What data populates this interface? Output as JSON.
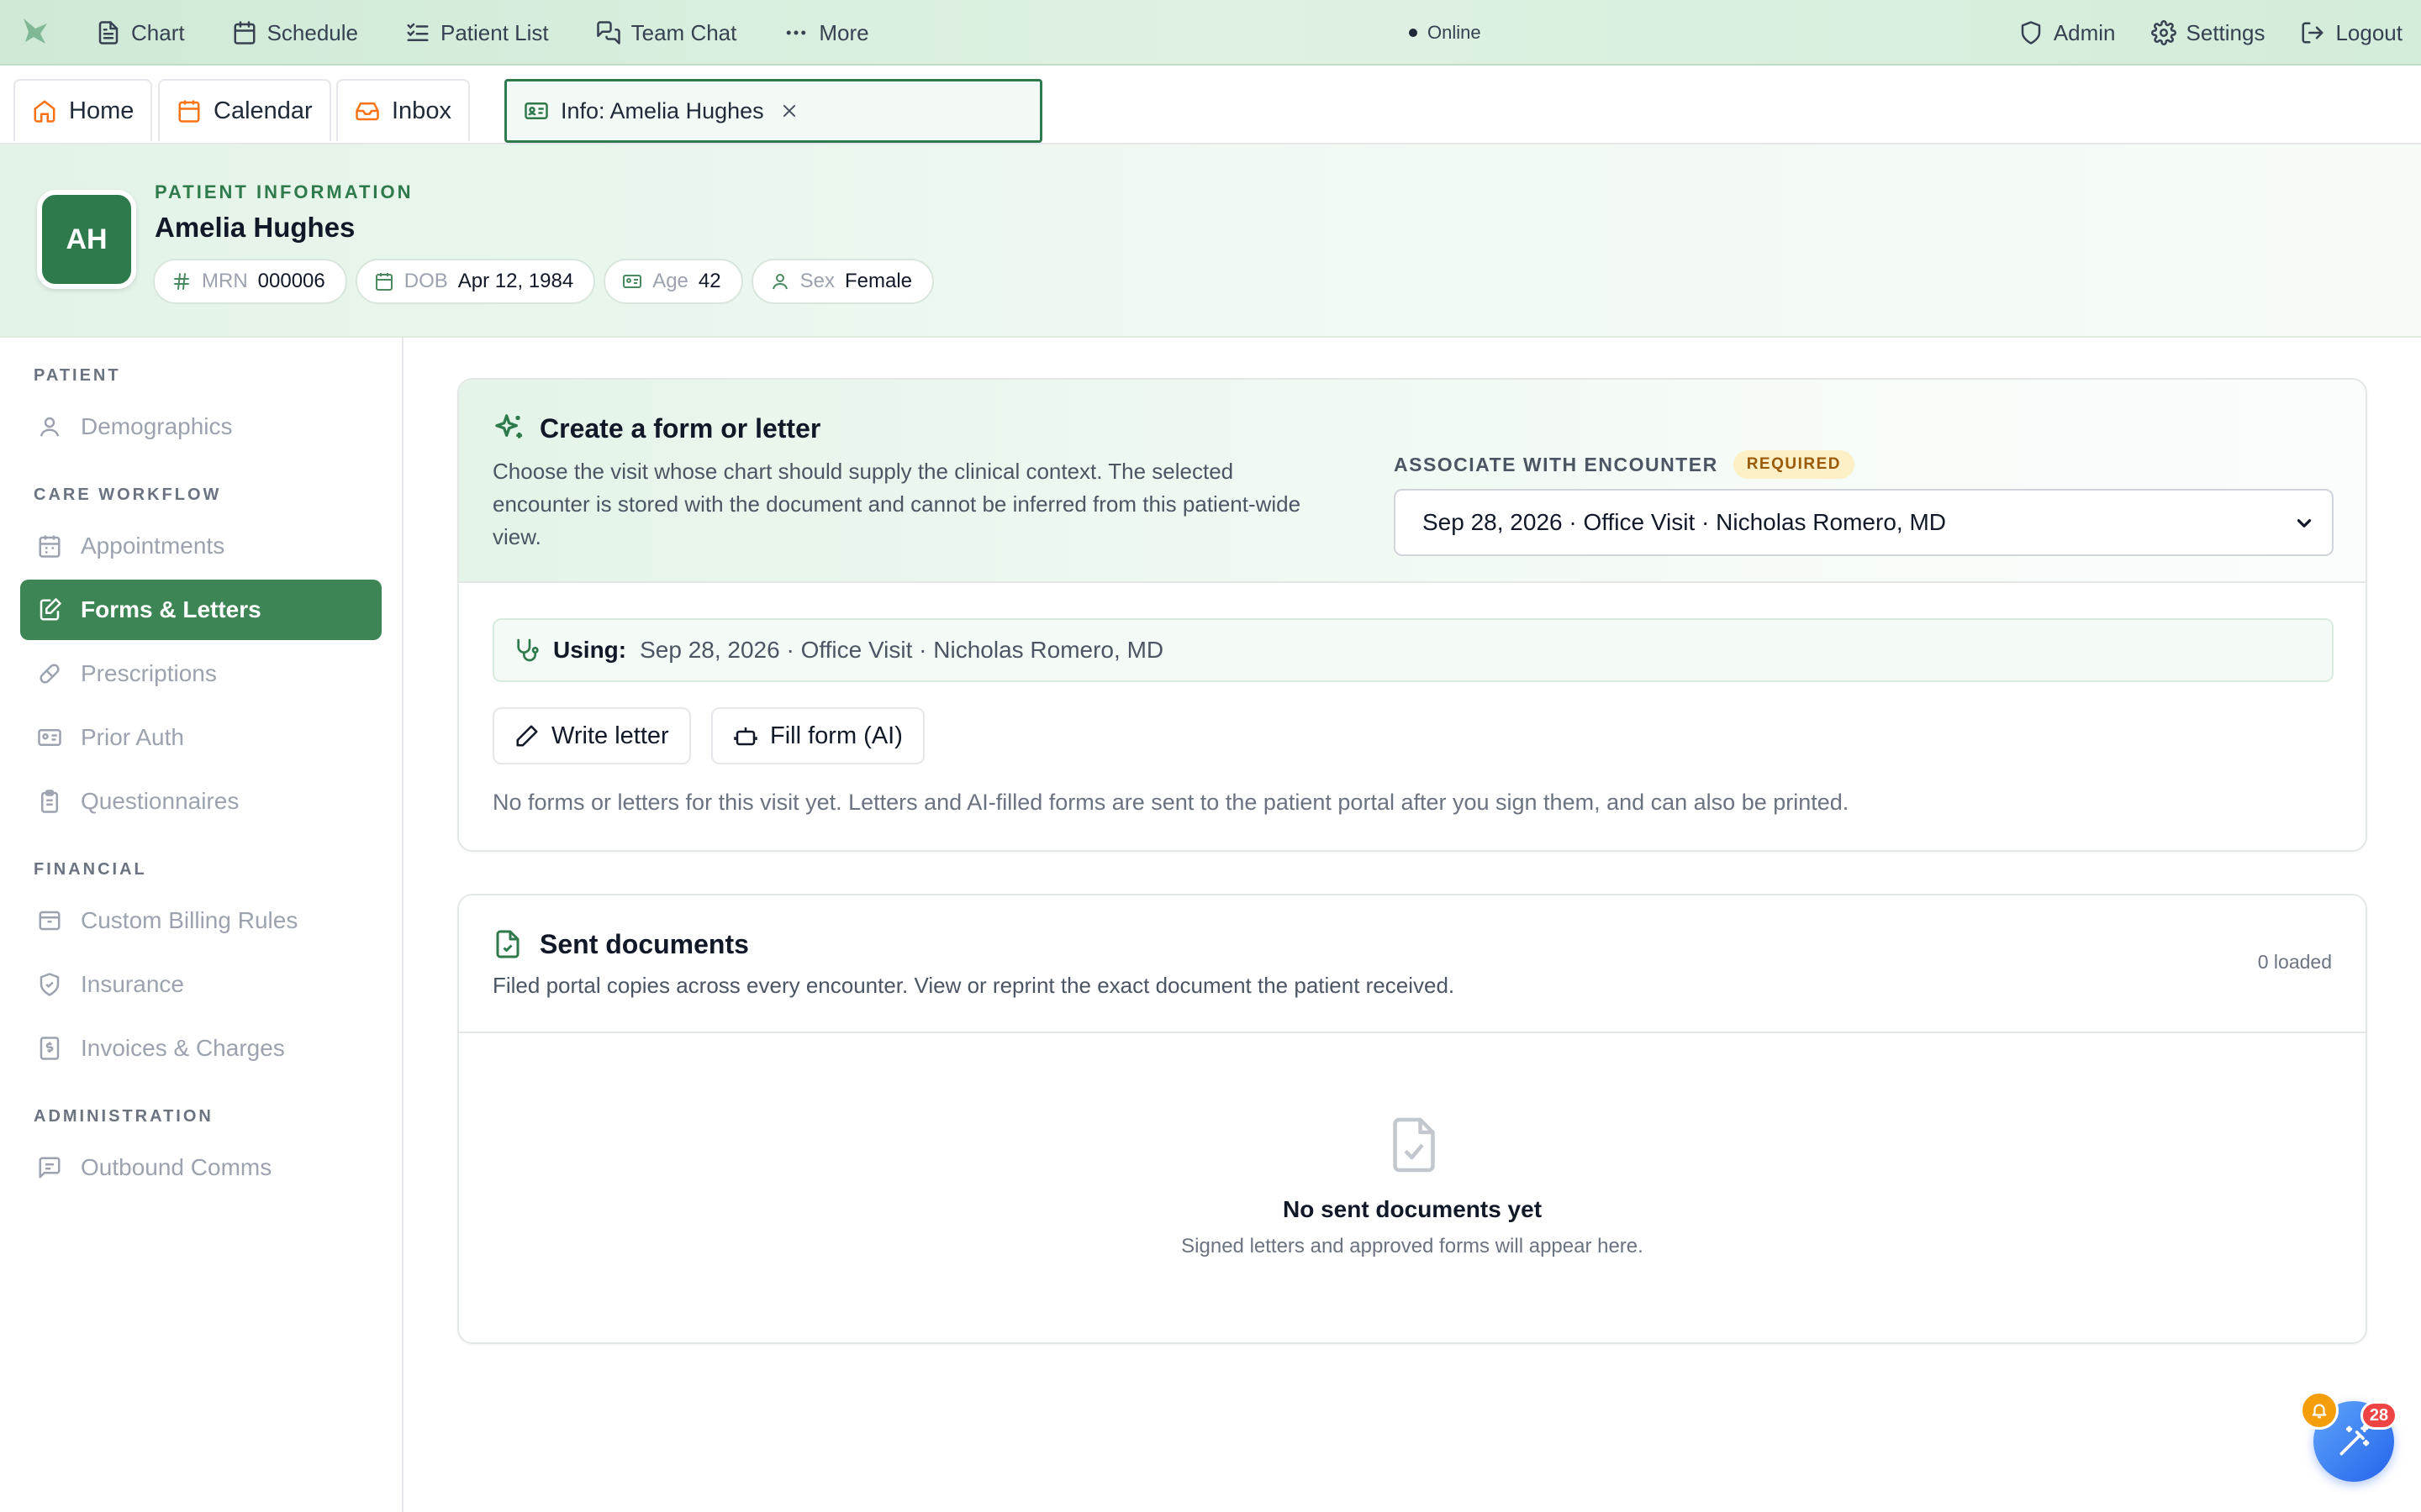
{
  "topnav": {
    "items": [
      {
        "label": "Chart",
        "icon": "document-icon"
      },
      {
        "label": "Schedule",
        "icon": "calendar-icon"
      },
      {
        "label": "Patient List",
        "icon": "checklist-icon"
      },
      {
        "label": "Team Chat",
        "icon": "chat-icon"
      },
      {
        "label": "More",
        "icon": "dots-icon"
      }
    ],
    "status": "Online",
    "right": [
      {
        "label": "Admin",
        "icon": "shield-icon"
      },
      {
        "label": "Settings",
        "icon": "gear-icon"
      },
      {
        "label": "Logout",
        "icon": "logout-icon"
      }
    ]
  },
  "tabs": {
    "home": "Home",
    "calendar": "Calendar",
    "inbox": "Inbox",
    "active": "Info: Amelia Hughes"
  },
  "patient": {
    "section_label": "PATIENT INFORMATION",
    "initials": "AH",
    "name": "Amelia Hughes",
    "mrn_label": "MRN",
    "mrn": "000006",
    "dob_label": "DOB",
    "dob": "Apr 12, 1984",
    "age_label": "Age",
    "age": "42",
    "sex_label": "Sex",
    "sex": "Female"
  },
  "sidebar": {
    "sections": [
      {
        "title": "PATIENT",
        "items": [
          {
            "label": "Demographics",
            "icon": "user-icon"
          }
        ]
      },
      {
        "title": "CARE WORKFLOW",
        "items": [
          {
            "label": "Appointments",
            "icon": "calendar-icon"
          },
          {
            "label": "Forms & Letters",
            "icon": "edit-document-icon",
            "active": true
          },
          {
            "label": "Prescriptions",
            "icon": "pill-icon"
          },
          {
            "label": "Prior Auth",
            "icon": "id-card-icon"
          },
          {
            "label": "Questionnaires",
            "icon": "clipboard-icon"
          }
        ]
      },
      {
        "title": "FINANCIAL",
        "items": [
          {
            "label": "Custom Billing Rules",
            "icon": "archive-icon"
          },
          {
            "label": "Insurance",
            "icon": "shield-check-icon"
          },
          {
            "label": "Invoices & Charges",
            "icon": "receipt-icon"
          }
        ]
      },
      {
        "title": "ADMINISTRATION",
        "items": [
          {
            "label": "Outbound Comms",
            "icon": "message-icon"
          }
        ]
      }
    ]
  },
  "create": {
    "title": "Create a form or letter",
    "description_line1": "Choose the visit whose chart should supply the clinical context. The selected",
    "description_line2": "encounter is stored with the document and cannot be inferred from this patient-wide",
    "description_line3": "view.",
    "assoc_label": "ASSOCIATE WITH ENCOUNTER",
    "required": "REQUIRED",
    "selected_encounter": "Sep 28, 2026 · Office Visit · Nicholas Romero, MD",
    "using_label": "Using:",
    "using_value": "Sep 28, 2026 · Office Visit · Nicholas Romero, MD",
    "write_letter": "Write letter",
    "fill_form": "Fill form (AI)",
    "empty_note": "No forms or letters for this visit yet. Letters and AI-filled forms are sent to the patient portal after you sign them, and can also be printed."
  },
  "sent": {
    "title": "Sent documents",
    "description": "Filed portal copies across every encounter. View or reprint the exact document the patient received.",
    "loaded": "0 loaded",
    "empty_title": "No sent documents yet",
    "empty_sub": "Signed letters and approved forms will appear here."
  },
  "fab": {
    "badge": "28"
  },
  "colors": {
    "brand": "#2f7a4d",
    "active_nav": "#3d8555",
    "accent_orange": "#f97316",
    "fab": "#2563eb",
    "badge": "#ef4444"
  }
}
